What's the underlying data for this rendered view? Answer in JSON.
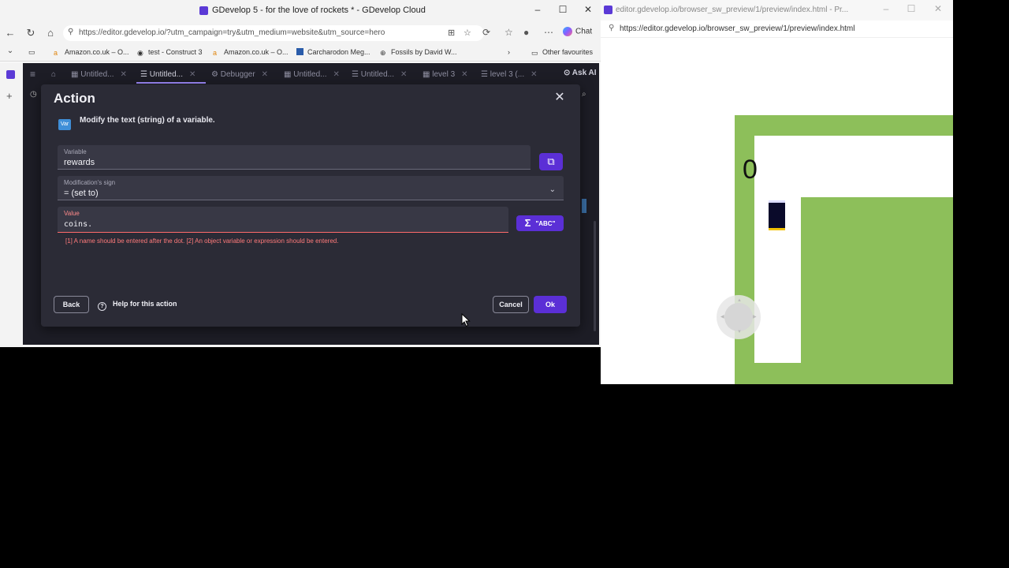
{
  "left_window": {
    "title": "GDevelop 5 - for the love of rockets * - GDevelop Cloud",
    "url": "https://editor.gdevelop.io/?utm_campaign=try&utm_medium=website&utm_source=hero",
    "chat_label": "Chat",
    "bookmarks": [
      "Amazon.co.uk – O...",
      "test - Construct 3",
      "Amazon.co.uk – O...",
      "Carcharodon Meg...",
      "Fossils by David W...",
      "Other favourites"
    ],
    "tabs": [
      {
        "label": "Untitled...",
        "active": false
      },
      {
        "label": "Untitled...",
        "active": true
      },
      {
        "label": "Debugger",
        "active": false
      },
      {
        "label": "Untitled...",
        "active": false
      },
      {
        "label": "Untitled...",
        "active": false
      },
      {
        "label": "level 3",
        "active": false
      },
      {
        "label": "level 3 (...",
        "active": false
      }
    ],
    "ask_ai": "Ask AI"
  },
  "dialog": {
    "title": "Action",
    "badge": "Var",
    "description": "Modify the text (string) of a variable.",
    "variable": {
      "label": "Variable",
      "value": "rewards"
    },
    "modification": {
      "label": "Modification's sign",
      "value": "= (set to)"
    },
    "value_field": {
      "label": "Value",
      "value": "coins."
    },
    "expression_button": "\"ABC\"",
    "error": "[1] A name should be entered after the dot. [2] An object variable or expression should be entered.",
    "back": "Back",
    "help": "Help for this action",
    "cancel": "Cancel",
    "ok": "Ok"
  },
  "right_window": {
    "title": "editor.gdevelop.io/browser_sw_preview/1/preview/index.html - Pr...",
    "url": "https://editor.gdevelop.io/browser_sw_preview/1/preview/index.html",
    "score": "0"
  },
  "colors": {
    "accent": "#5b2fd6",
    "error": "#ff6b6b",
    "grass": "#8dbf5a",
    "dialog_bg": "#2b2b36"
  }
}
